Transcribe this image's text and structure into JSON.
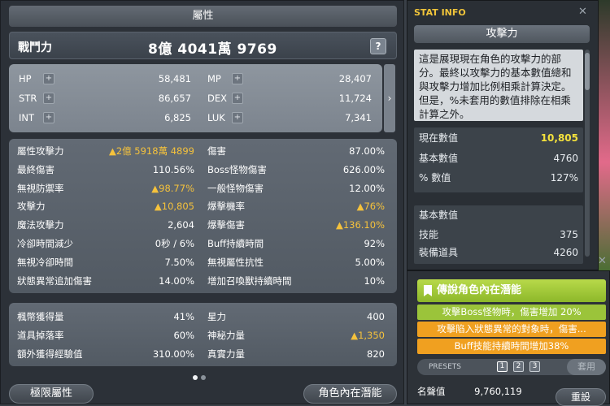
{
  "stat": {
    "title": "屬性",
    "combat_power_label": "戰鬥力",
    "combat_power_value": "8億 4041萬 9769",
    "help": "?",
    "basic": [
      {
        "k": "HP",
        "v": "58,481"
      },
      {
        "k": "MP",
        "v": "28,407"
      },
      {
        "k": "STR",
        "v": "86,657"
      },
      {
        "k": "DEX",
        "v": "11,724"
      },
      {
        "k": "INT",
        "v": "6,825"
      },
      {
        "k": "LUK",
        "v": "7,341"
      }
    ],
    "detail_left": [
      {
        "k": "屬性攻擊力",
        "v": "▲2億 5918萬 4899",
        "up": true
      },
      {
        "k": "最終傷害",
        "v": "110.56%"
      },
      {
        "k": "無視防禦率",
        "v": "▲98.77%",
        "up": true
      },
      {
        "k": "攻擊力",
        "v": "▲10,805",
        "up": true
      },
      {
        "k": "魔法攻擊力",
        "v": "2,604"
      },
      {
        "k": "冷卻時間減少",
        "v": "0秒 / 6%"
      },
      {
        "k": "無視冷卻時間",
        "v": "7.50%"
      },
      {
        "k": "狀態異常追加傷害",
        "v": "14.00%"
      }
    ],
    "detail_right": [
      {
        "k": "傷害",
        "v": "87.00%"
      },
      {
        "k": "Boss怪物傷害",
        "v": "626.00%"
      },
      {
        "k": "一般怪物傷害",
        "v": "12.00%"
      },
      {
        "k": "爆擊機率",
        "v": "▲76%",
        "up": true
      },
      {
        "k": "爆擊傷害",
        "v": "▲136.10%",
        "up": true
      },
      {
        "k": "Buff持續時間",
        "v": "92%"
      },
      {
        "k": "無視屬性抗性",
        "v": "5.00%"
      },
      {
        "k": "增加召喚獸持續時間",
        "v": "10%"
      }
    ],
    "extra_left": [
      {
        "k": "楓幣獲得量",
        "v": "41%"
      },
      {
        "k": "道具掉落率",
        "v": "60%"
      },
      {
        "k": "額外獲得經驗值",
        "v": "310.00%"
      }
    ],
    "extra_right": [
      {
        "k": "星力",
        "v": "400"
      },
      {
        "k": "神秘力量",
        "v": "▲1,350",
        "up": true
      },
      {
        "k": "真實力量",
        "v": "820"
      }
    ],
    "btn_limit": "極限屬性",
    "btn_inner": "角色內在潛能"
  },
  "info": {
    "title": "STAT INFO",
    "sub": "攻擊力",
    "desc": "這是展現現在角色的攻擊力的部分。最終以攻擊力的基本數值總和與攻擊力增加比例相乘計算決定。但是，%未套用的數值排除在相乘計算之外。",
    "current_label": "現在數值",
    "current_value": "10,805",
    "base_label": "基本數值",
    "base_value": "4760",
    "pct_label": "% 數值",
    "pct_value": "127%",
    "section_label": "基本數值",
    "skill_label": "技能",
    "skill_value": "375",
    "equip_label": "裝備道具",
    "equip_value": "4260"
  },
  "potential": {
    "head": "傳說角色內在潛能",
    "lines": [
      "攻擊Boss怪物時，傷害增加 20%",
      "攻擊陷入狀態異常的對象時，傷害...",
      "Buff技能持續時間增加38%"
    ],
    "presets_label": "PRESETS",
    "preset_nums": [
      "1",
      "2",
      "3"
    ],
    "apply": "套用",
    "fame_label": "名聲值",
    "fame_value": "9,760,119",
    "reset": "重設"
  },
  "colors": {
    "legendary": "#9bc43a",
    "unique": "#f0a020",
    "up": "#f5c23c"
  }
}
